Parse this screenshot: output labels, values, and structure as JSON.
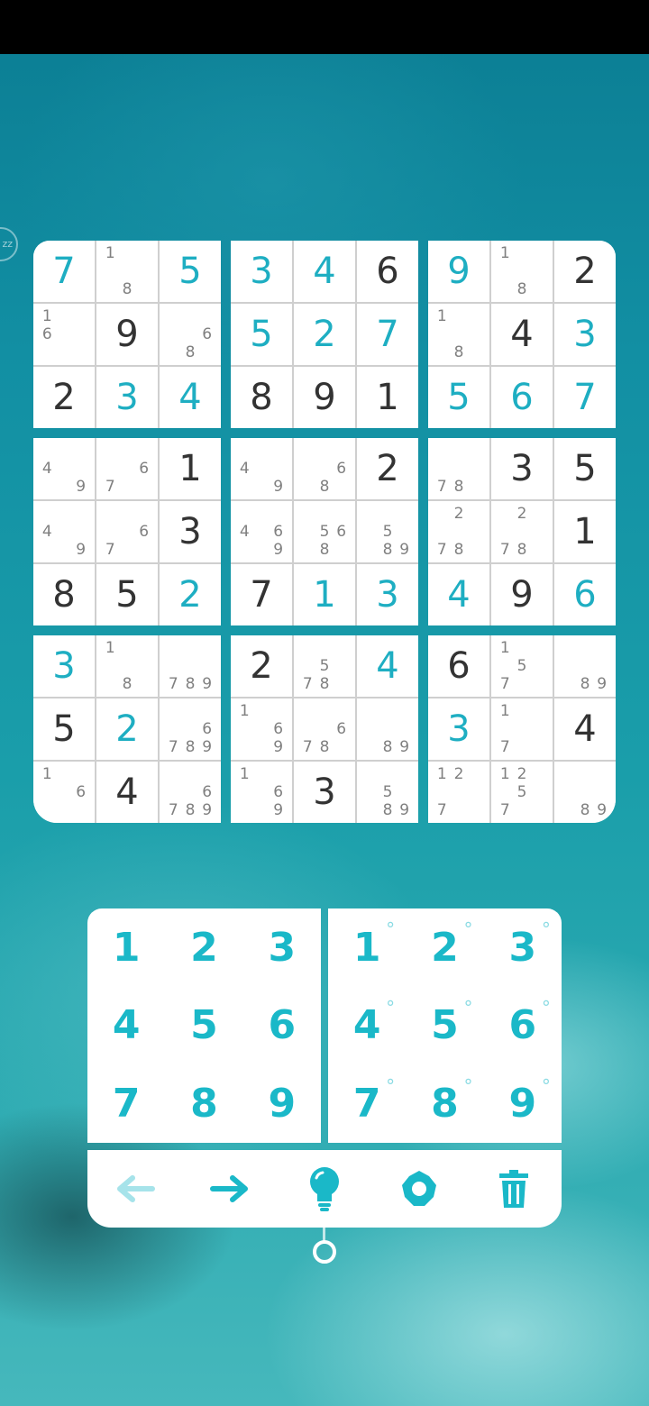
{
  "side_handle": {
    "text": "zz"
  },
  "board": {
    "boxes": [
      {
        "cells": [
          {
            "v": "7",
            "t": "user"
          },
          {
            "n": [
              "1",
              "",
              "",
              "",
              "",
              "",
              "",
              "8",
              ""
            ]
          },
          {
            "v": "5",
            "t": "user"
          },
          {
            "n": [
              "1",
              "",
              "",
              "6",
              "",
              "",
              "",
              "",
              ""
            ]
          },
          {
            "v": "9",
            "t": "given"
          },
          {
            "n": [
              "",
              "",
              "",
              "",
              "",
              "6",
              "",
              "8",
              ""
            ]
          },
          {
            "v": "2",
            "t": "given"
          },
          {
            "v": "3",
            "t": "user"
          },
          {
            "v": "4",
            "t": "user"
          }
        ]
      },
      {
        "cells": [
          {
            "v": "3",
            "t": "user"
          },
          {
            "v": "4",
            "t": "user"
          },
          {
            "v": "6",
            "t": "given"
          },
          {
            "v": "5",
            "t": "user"
          },
          {
            "v": "2",
            "t": "user"
          },
          {
            "v": "7",
            "t": "user"
          },
          {
            "v": "8",
            "t": "given"
          },
          {
            "v": "9",
            "t": "given"
          },
          {
            "v": "1",
            "t": "given"
          }
        ]
      },
      {
        "cells": [
          {
            "v": "9",
            "t": "user"
          },
          {
            "n": [
              "1",
              "",
              "",
              "",
              "",
              "",
              "",
              "8",
              ""
            ]
          },
          {
            "v": "2",
            "t": "given"
          },
          {
            "n": [
              "1",
              "",
              "",
              "",
              "",
              "",
              "",
              "8",
              ""
            ]
          },
          {
            "v": "4",
            "t": "given"
          },
          {
            "v": "3",
            "t": "user"
          },
          {
            "v": "5",
            "t": "user"
          },
          {
            "v": "6",
            "t": "user"
          },
          {
            "v": "7",
            "t": "user"
          }
        ]
      },
      {
        "cells": [
          {
            "n": [
              "",
              "",
              "",
              "4",
              "",
              "",
              "",
              "",
              "9"
            ]
          },
          {
            "n": [
              "",
              "",
              "",
              "",
              "",
              "6",
              "7",
              "",
              ""
            ]
          },
          {
            "v": "1",
            "t": "given"
          },
          {
            "n": [
              "",
              "",
              "",
              "4",
              "",
              "",
              "",
              "",
              "9"
            ]
          },
          {
            "n": [
              "",
              "",
              "",
              "",
              "",
              "6",
              "7",
              "",
              ""
            ]
          },
          {
            "v": "3",
            "t": "given"
          },
          {
            "v": "8",
            "t": "given"
          },
          {
            "v": "5",
            "t": "given"
          },
          {
            "v": "2",
            "t": "user"
          }
        ]
      },
      {
        "cells": [
          {
            "n": [
              "",
              "",
              "",
              "4",
              "",
              "",
              "",
              "",
              "9"
            ]
          },
          {
            "n": [
              "",
              "",
              "",
              "",
              "",
              "6",
              "",
              "8",
              ""
            ]
          },
          {
            "v": "2",
            "t": "given"
          },
          {
            "n": [
              "",
              "",
              "",
              "4",
              "",
              "6",
              "",
              "",
              "9"
            ]
          },
          {
            "n": [
              "",
              "",
              "",
              "",
              "5",
              "6",
              "",
              "8",
              ""
            ]
          },
          {
            "n": [
              "",
              "",
              "",
              "",
              "5",
              "",
              "",
              "8",
              "9"
            ]
          },
          {
            "v": "7",
            "t": "given"
          },
          {
            "v": "1",
            "t": "user"
          },
          {
            "v": "3",
            "t": "user"
          }
        ]
      },
      {
        "cells": [
          {
            "n": [
              "",
              "",
              "",
              "",
              "",
              "",
              "7",
              "8",
              ""
            ]
          },
          {
            "v": "3",
            "t": "given"
          },
          {
            "v": "5",
            "t": "given"
          },
          {
            "n": [
              "",
              "2",
              "",
              "",
              "",
              "",
              "7",
              "8",
              ""
            ]
          },
          {
            "n": [
              "",
              "2",
              "",
              "",
              "",
              "",
              "7",
              "8",
              ""
            ]
          },
          {
            "v": "1",
            "t": "given"
          },
          {
            "v": "4",
            "t": "user"
          },
          {
            "v": "9",
            "t": "given"
          },
          {
            "v": "6",
            "t": "user"
          }
        ]
      },
      {
        "cells": [
          {
            "v": "3",
            "t": "user"
          },
          {
            "n": [
              "1",
              "",
              "",
              "",
              "",
              "",
              "",
              "8",
              ""
            ]
          },
          {
            "n": [
              "",
              "",
              "",
              "",
              "",
              "",
              "7",
              "8",
              "9"
            ]
          },
          {
            "v": "5",
            "t": "given"
          },
          {
            "v": "2",
            "t": "user"
          },
          {
            "n": [
              "",
              "",
              "",
              "",
              "",
              "6",
              "7",
              "8",
              "9"
            ]
          },
          {
            "n": [
              "1",
              "",
              "",
              "",
              "",
              "6",
              "",
              "",
              ""
            ]
          },
          {
            "v": "4",
            "t": "given"
          },
          {
            "n": [
              "",
              "",
              "",
              "",
              "",
              "6",
              "7",
              "8",
              "9"
            ]
          }
        ]
      },
      {
        "cells": [
          {
            "v": "2",
            "t": "given"
          },
          {
            "n": [
              "",
              "",
              "",
              "",
              "5",
              "",
              "7",
              "8",
              ""
            ]
          },
          {
            "v": "4",
            "t": "user"
          },
          {
            "n": [
              "1",
              "",
              "",
              "",
              "",
              "6",
              "",
              "",
              "9"
            ]
          },
          {
            "n": [
              "",
              "",
              "",
              "",
              "",
              "6",
              "7",
              "8",
              ""
            ]
          },
          {
            "n": [
              "",
              "",
              "",
              "",
              "",
              "",
              "",
              "8",
              "9"
            ]
          },
          {
            "n": [
              "1",
              "",
              "",
              "",
              "",
              "6",
              "",
              "",
              "9"
            ]
          },
          {
            "v": "3",
            "t": "given"
          },
          {
            "n": [
              "",
              "",
              "",
              "",
              "5",
              "",
              "",
              "8",
              "9"
            ]
          }
        ]
      },
      {
        "cells": [
          {
            "v": "6",
            "t": "given"
          },
          {
            "n": [
              "1",
              "",
              "",
              "",
              "5",
              "",
              "7",
              "",
              ""
            ]
          },
          {
            "n": [
              "",
              "",
              "",
              "",
              "",
              "",
              "",
              "8",
              "9"
            ]
          },
          {
            "v": "3",
            "t": "user"
          },
          {
            "n": [
              "1",
              "",
              "",
              "",
              "",
              "",
              "7",
              "",
              ""
            ]
          },
          {
            "v": "4",
            "t": "given"
          },
          {
            "n": [
              "1",
              "2",
              "",
              "",
              "",
              "",
              "7",
              "",
              ""
            ]
          },
          {
            "n": [
              "1",
              "2",
              "",
              "",
              "5",
              "",
              "7",
              "",
              ""
            ]
          },
          {
            "n": [
              "",
              "",
              "",
              "",
              "",
              "",
              "",
              "8",
              "9"
            ]
          }
        ]
      }
    ]
  },
  "pad": {
    "values": [
      "1",
      "2",
      "3",
      "4",
      "5",
      "6",
      "7",
      "8",
      "9"
    ],
    "notes": [
      "1",
      "2",
      "3",
      "4",
      "5",
      "6",
      "7",
      "8",
      "9"
    ],
    "note_mark": "°"
  },
  "toolbar": {
    "items": [
      {
        "name": "undo-arrow-icon",
        "color": "#a6e3ea"
      },
      {
        "name": "redo-arrow-icon",
        "color": "#1ab8c8"
      },
      {
        "name": "hint-lightbulb-icon",
        "color": "#1ab8c8"
      },
      {
        "name": "settings-gear-icon",
        "color": "#1ab8c8"
      },
      {
        "name": "trash-icon",
        "color": "#1ab8c8"
      }
    ]
  },
  "colors": {
    "accent": "#1ab8c8",
    "user_digit": "#1eaec2",
    "given_digit": "#333333",
    "note": "#808080"
  }
}
